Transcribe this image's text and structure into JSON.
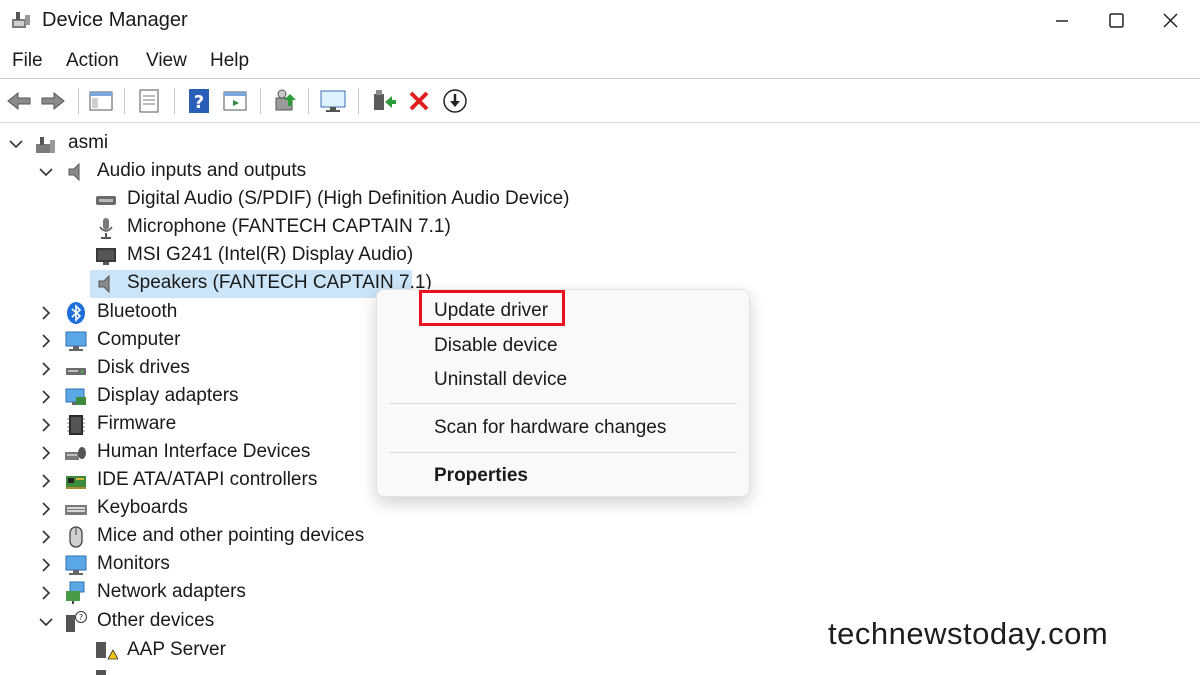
{
  "window": {
    "title": "Device Manager"
  },
  "menu": [
    "File",
    "Action",
    "View",
    "Help"
  ],
  "tree": {
    "root": "asmi",
    "audio": {
      "label": "Audio inputs and outputs",
      "children": [
        "Digital Audio (S/PDIF) (High Definition Audio Device)",
        "Microphone (FANTECH CAPTAIN 7.1)",
        "MSI G241 (Intel(R) Display Audio)",
        "Speakers (FANTECH CAPTAIN 7.1)"
      ]
    },
    "categories": [
      "Bluetooth",
      "Computer",
      "Disk drives",
      "Display adapters",
      "Firmware",
      "Human Interface Devices",
      "IDE ATA/ATAPI controllers",
      "Keyboards",
      "Mice and other pointing devices",
      "Monitors",
      "Network adapters"
    ],
    "other": {
      "label": "Other devices",
      "children": [
        "AAP Server"
      ]
    }
  },
  "context_menu": {
    "items": [
      "Update driver",
      "Disable device",
      "Uninstall device",
      "Scan for hardware changes",
      "Properties"
    ]
  },
  "watermark": "technewstoday.com"
}
